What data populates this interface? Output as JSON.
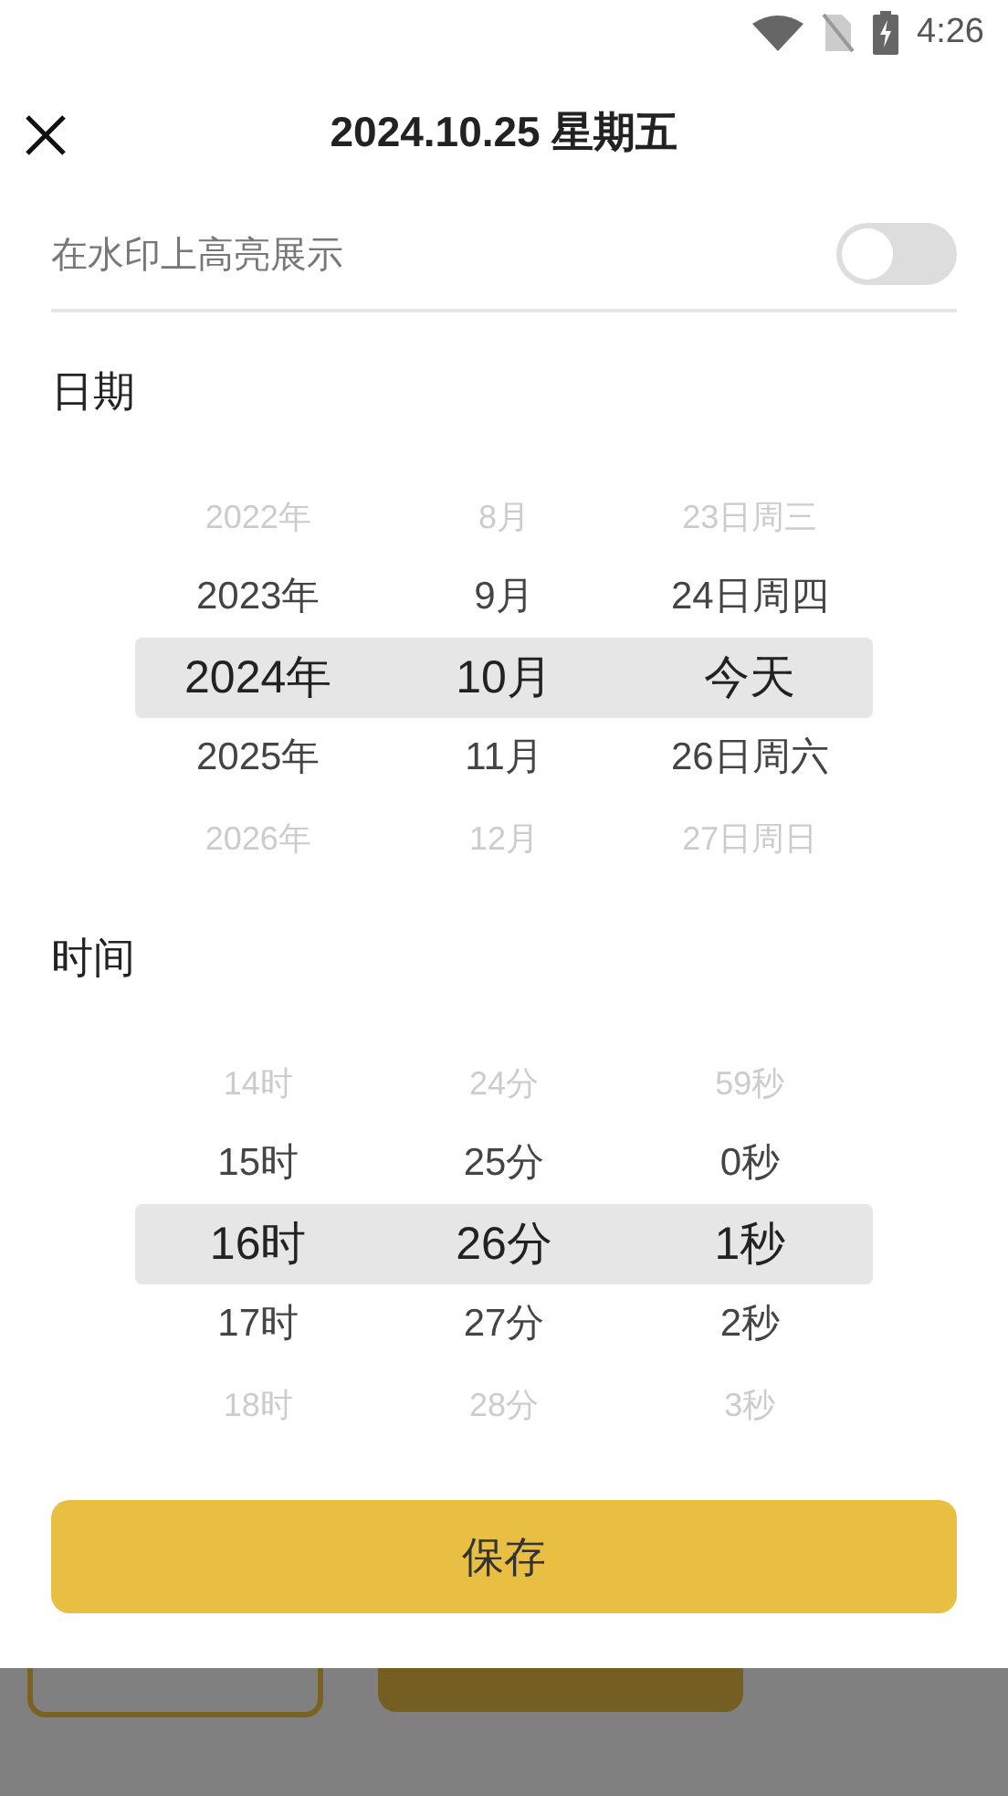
{
  "status_bar": {
    "time": "4:26"
  },
  "header": {
    "title": "2024.10.25 星期五"
  },
  "toggle": {
    "label": "在水印上高亮展示",
    "on": false
  },
  "pickers": [
    {
      "label": "日期",
      "columns": [
        {
          "items": [
            {
              "text": "2022年",
              "selected": false
            },
            {
              "text": "2023年",
              "selected": false
            },
            {
              "text": "2024年",
              "selected": true
            },
            {
              "text": "2025年",
              "selected": false
            },
            {
              "text": "2026年",
              "selected": false
            }
          ]
        },
        {
          "items": [
            {
              "text": "8月",
              "selected": false
            },
            {
              "text": "9月",
              "selected": false
            },
            {
              "text": "10月",
              "selected": true
            },
            {
              "text": "11月",
              "selected": false
            },
            {
              "text": "12月",
              "selected": false
            }
          ]
        },
        {
          "items": [
            {
              "text": "23日周三",
              "selected": false
            },
            {
              "text": "24日周四",
              "selected": false
            },
            {
              "text": "今天",
              "selected": true
            },
            {
              "text": "26日周六",
              "selected": false
            },
            {
              "text": "27日周日",
              "selected": false
            }
          ]
        }
      ]
    },
    {
      "label": "时间",
      "columns": [
        {
          "items": [
            {
              "text": "14时",
              "selected": false
            },
            {
              "text": "15时",
              "selected": false
            },
            {
              "text": "16时",
              "selected": true
            },
            {
              "text": "17时",
              "selected": false
            },
            {
              "text": "18时",
              "selected": false
            }
          ]
        },
        {
          "items": [
            {
              "text": "24分",
              "selected": false
            },
            {
              "text": "25分",
              "selected": false
            },
            {
              "text": "26分",
              "selected": true
            },
            {
              "text": "27分",
              "selected": false
            },
            {
              "text": "28分",
              "selected": false
            }
          ]
        },
        {
          "items": [
            {
              "text": "59秒",
              "selected": false
            },
            {
              "text": "0秒",
              "selected": false
            },
            {
              "text": "1秒",
              "selected": true
            },
            {
              "text": "2秒",
              "selected": false
            },
            {
              "text": "3秒",
              "selected": false
            }
          ]
        }
      ]
    }
  ],
  "save_button": {
    "label": "保存"
  }
}
